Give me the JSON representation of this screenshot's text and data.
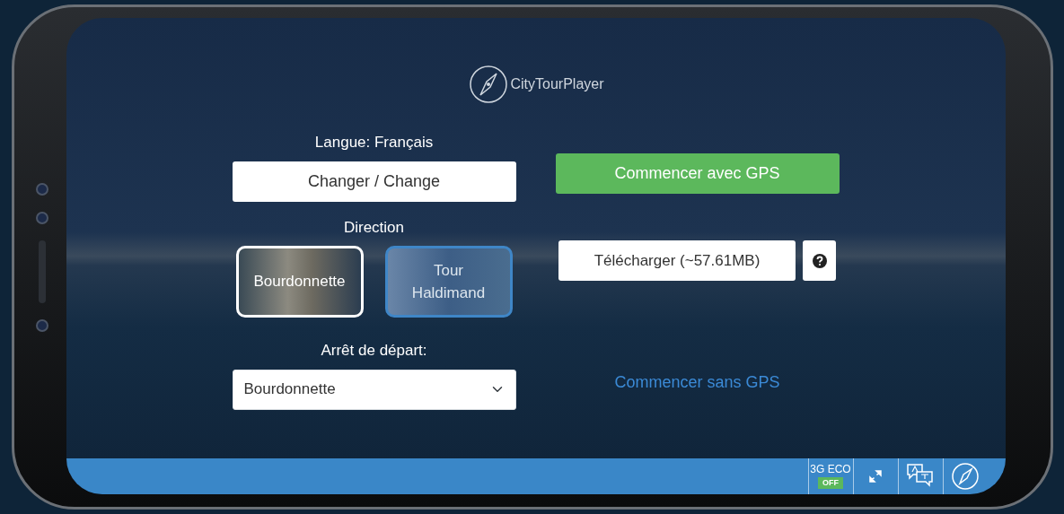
{
  "logo": {
    "text": "CityTourPlayer"
  },
  "language": {
    "label": "Langue: Français",
    "button": "Changer / Change"
  },
  "direction": {
    "label": "Direction",
    "options": [
      {
        "label": "Bourdonnette",
        "selected": true
      },
      {
        "label": "Tour Haldimand",
        "selected": false
      }
    ]
  },
  "start_stop": {
    "label": "Arrêt de départ:",
    "value": "Bourdonnette"
  },
  "gps_button": "Commencer avec GPS",
  "download_button": "Télécharger (~57.61MB)",
  "no_gps_link": "Commencer sans GPS",
  "toolbar": {
    "eco_label": "3G ECO",
    "eco_state": "OFF"
  }
}
